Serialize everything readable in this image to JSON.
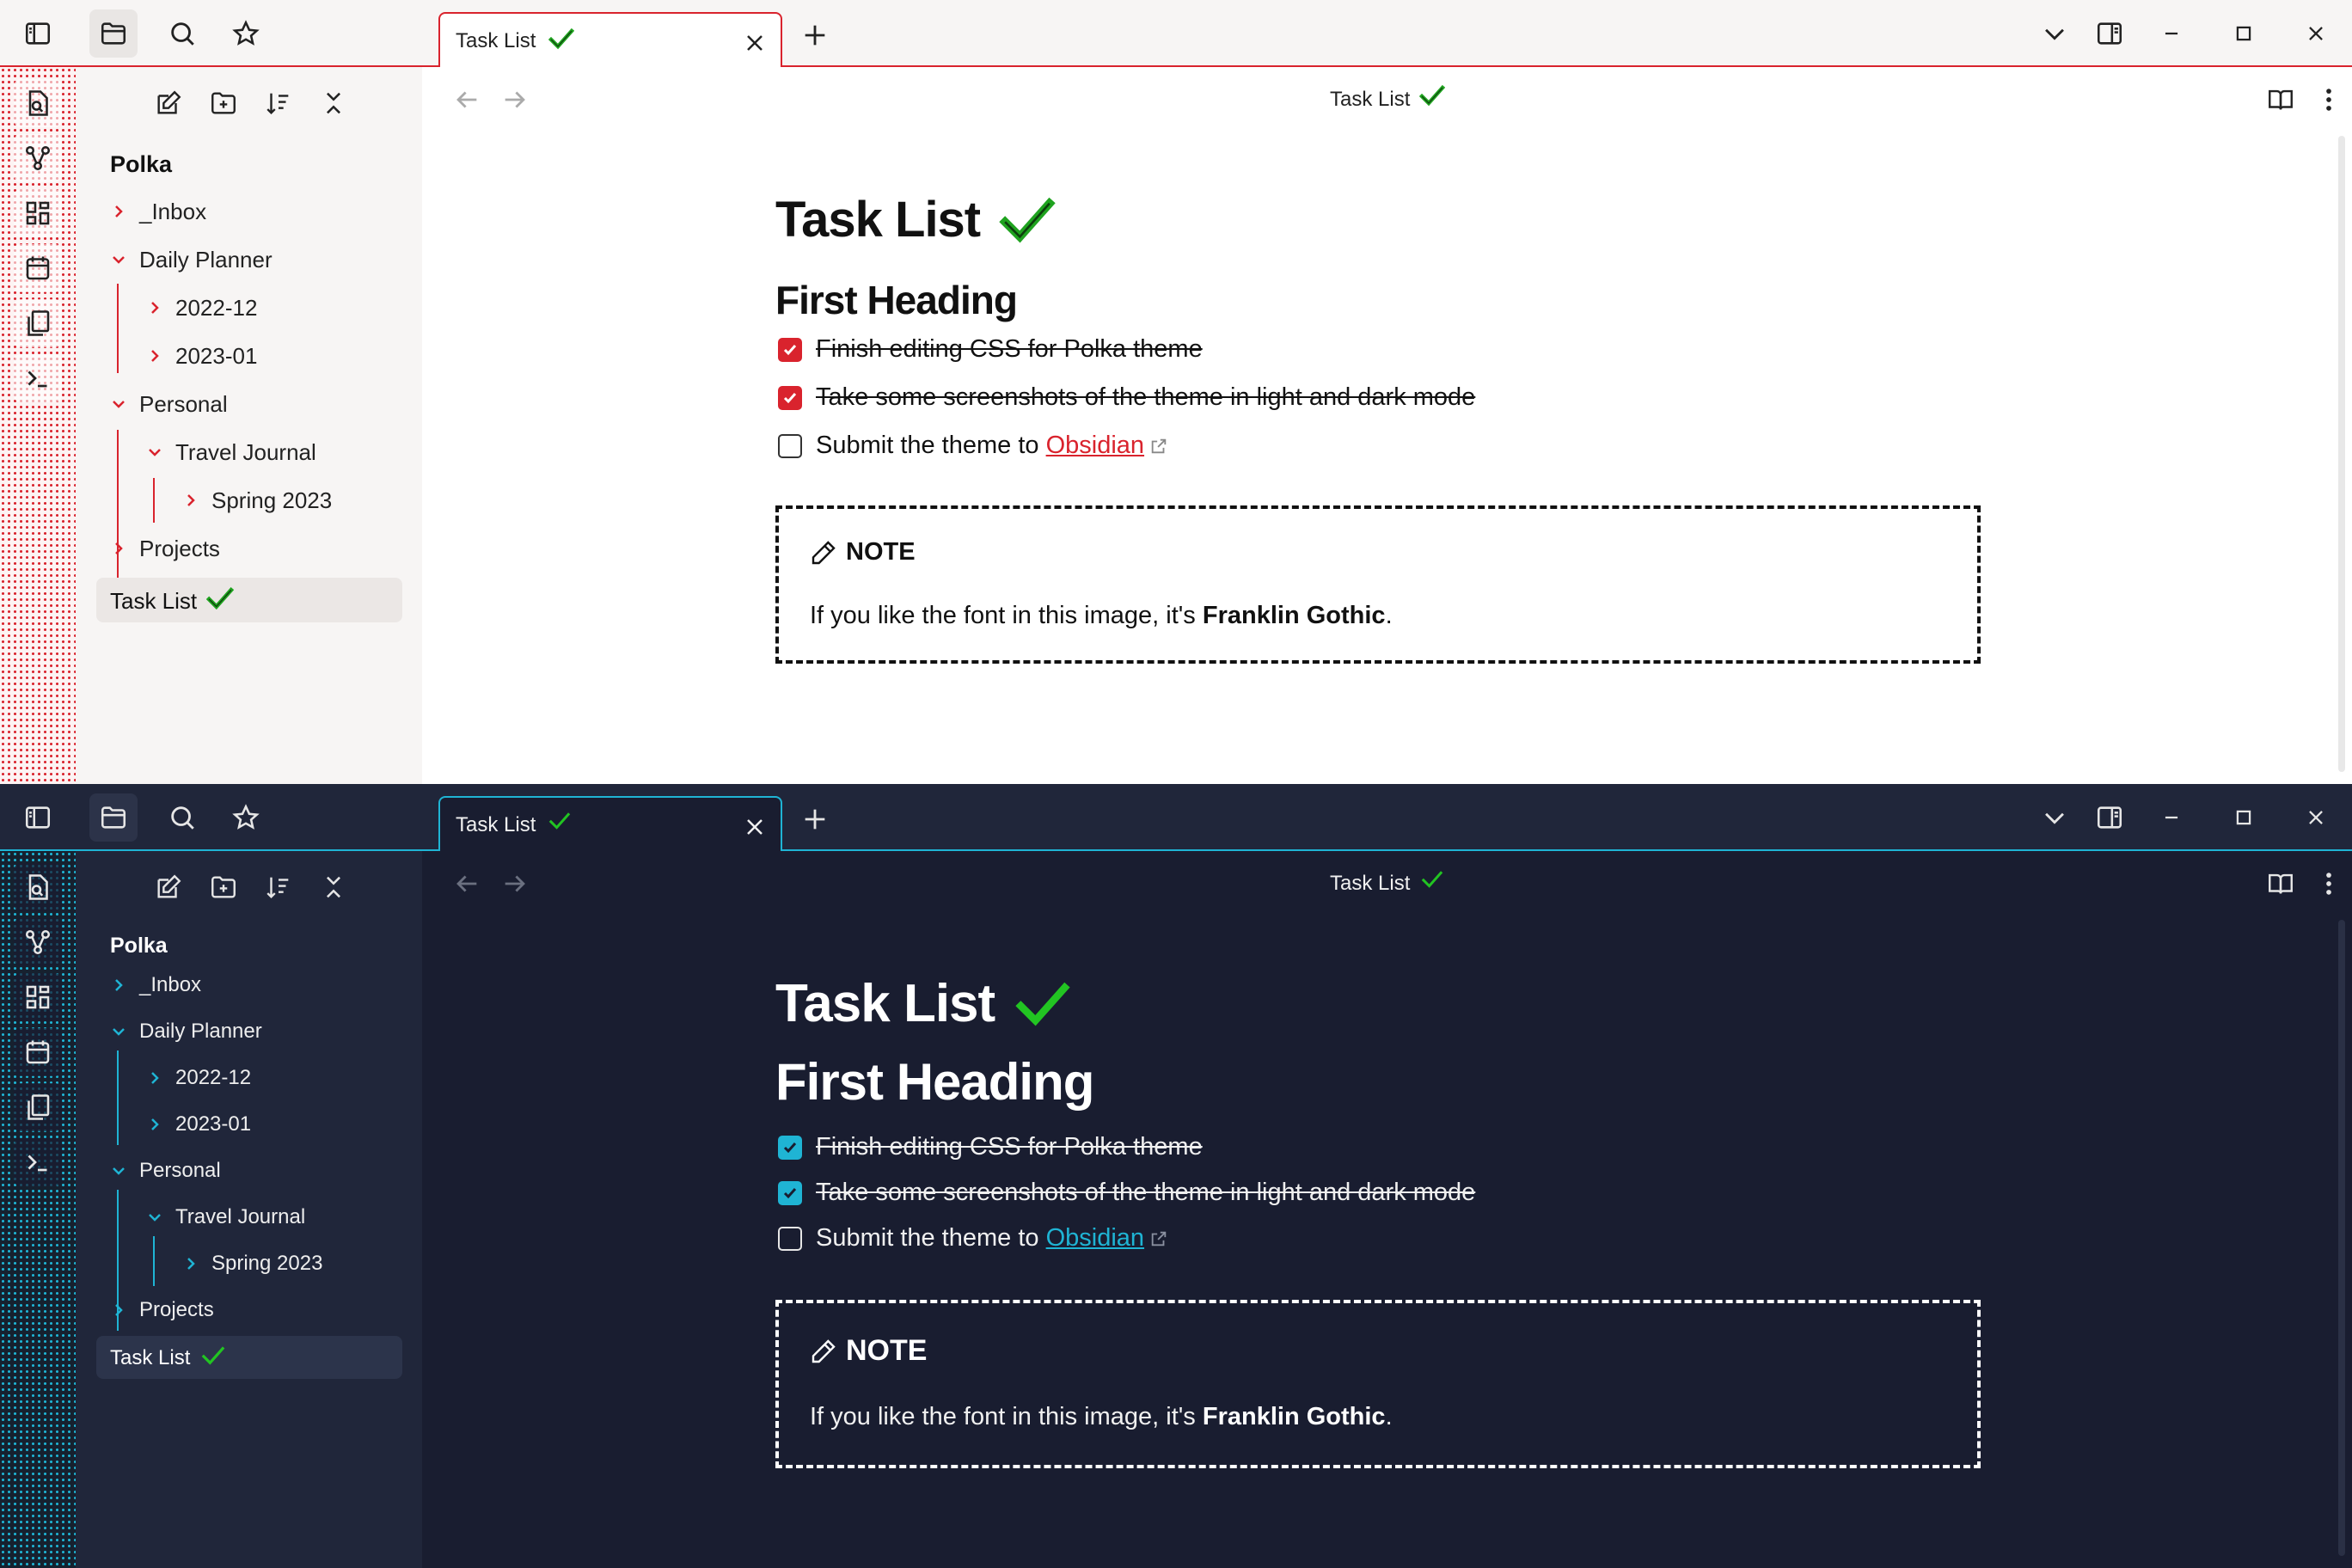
{
  "colors": {
    "light_accent": "#d9232d",
    "dark_accent": "#1fb4d4",
    "check_green": "#1fa31f",
    "light_bg": "#ffffff",
    "light_sidebar_bg": "#f7f5f4",
    "dark_bg": "#191d30",
    "dark_sidebar_bg": "#20263a"
  },
  "ribbon": {
    "top_icons": [
      "sidebar-toggle-icon",
      "folder-icon",
      "search-icon",
      "star-icon"
    ],
    "left_icons": [
      "file-search-icon",
      "graph-icon",
      "dashboard-icon",
      "calendar-icon",
      "copy-icon",
      "terminal-icon"
    ]
  },
  "tab": {
    "title": "Task List"
  },
  "explorer": {
    "toolbar_icons": [
      "new-note-icon",
      "new-folder-icon",
      "sort-icon",
      "collapse-all-icon"
    ],
    "vault_name": "Polka",
    "items": [
      {
        "label": "_Inbox",
        "expanded": false
      },
      {
        "label": "Daily Planner",
        "expanded": true
      },
      {
        "label": "2022-12",
        "expanded": false
      },
      {
        "label": "2023-01",
        "expanded": false
      },
      {
        "label": "Personal",
        "expanded": true
      },
      {
        "label": "Travel Journal",
        "expanded": true
      },
      {
        "label": "Spring 2023",
        "expanded": false
      },
      {
        "label": "Projects",
        "expanded": false
      }
    ],
    "active_file": "Task List"
  },
  "view_header": {
    "title": "Task List"
  },
  "note": {
    "title": "Task List",
    "heading": "First Heading",
    "tasks": [
      {
        "text": "Finish editing CSS for Polka theme",
        "done": true
      },
      {
        "text": "Take some screenshots of the theme in light and dark mode",
        "done": true
      },
      {
        "text": "Submit the theme to ",
        "link": "Obsidian",
        "done": false
      }
    ],
    "callout": {
      "type_label": "NOTE",
      "body_prefix": "If you like the font in this image, it's ",
      "body_bold": "Franklin Gothic",
      "body_suffix": "."
    }
  }
}
